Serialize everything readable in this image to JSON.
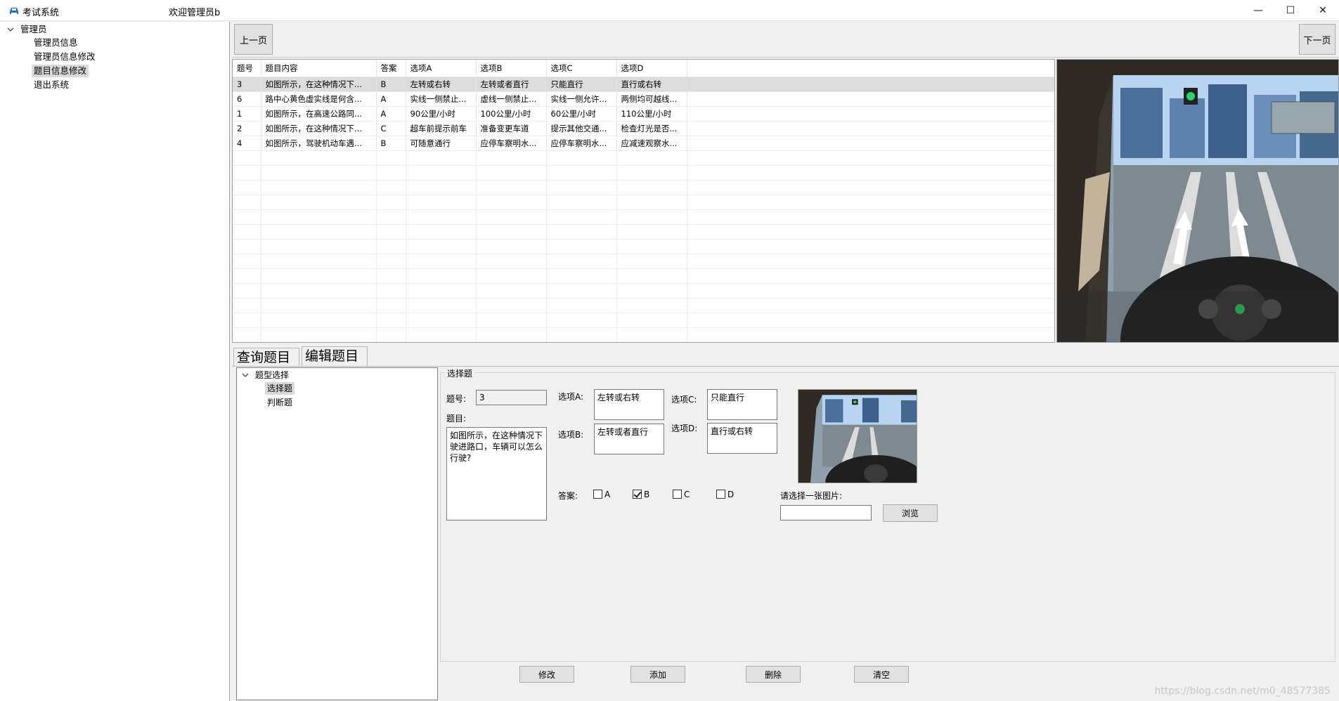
{
  "window": {
    "app_title": "考试系统",
    "welcome": "欢迎管理员b",
    "app_icon": "car-icon",
    "controls": {
      "minimize": "—",
      "maximize": "☐",
      "close": "✕"
    }
  },
  "nav": {
    "root": "管理员",
    "items": [
      {
        "label": "管理员信息"
      },
      {
        "label": "管理员信息修改"
      },
      {
        "label": "题目信息修改"
      },
      {
        "label": "退出系统"
      }
    ],
    "selected": "题目信息修改"
  },
  "pager": {
    "prev": "上一页",
    "next": "下一页"
  },
  "grid": {
    "columns": [
      "题号",
      "题目内容",
      "答案",
      "选项A",
      "选项B",
      "选项C",
      "选项D"
    ],
    "rows": [
      [
        "3",
        "如图所示，在这种情况下...",
        "B",
        "左转或右转",
        "左转或者直行",
        "只能直行",
        "直行或右转"
      ],
      [
        "6",
        "路中心黄色虚实线是何含...",
        "A",
        "实线一侧禁止...",
        "虚线一侧禁止...",
        "实线一侧允许...",
        "两侧均可越线..."
      ],
      [
        "1",
        "如图所示，在高速公路同...",
        "A",
        "90公里/小时",
        "100公里/小时",
        "60公里/小时",
        "110公里/小时"
      ],
      [
        "2",
        "如图所示，在这种情况下...",
        "C",
        "超车前提示前车",
        "准备变更车道",
        "提示其他交通...",
        "检查灯光是否..."
      ],
      [
        "4",
        "如图所示，驾驶机动车遇...",
        "B",
        "可随意通行",
        "应停车察明水...",
        "应停车察明水...",
        "应减速观察水..."
      ]
    ],
    "selected_row": 0
  },
  "tabs": {
    "query": "查询题目",
    "edit": "编辑题目"
  },
  "type_tree": {
    "root": "题型选择",
    "items": [
      "选择题",
      "判断题"
    ],
    "selected": "选择题"
  },
  "form": {
    "group_title": "选择题",
    "number_label": "题号:",
    "number_value": "3",
    "question_label": "题目:",
    "question_text": "如图所示，在这种情况下驶进路口，车辆可以怎么行驶?",
    "optA_label": "选项A:",
    "optA_value": "左转或右转",
    "optB_label": "选项B:",
    "optB_value": "左转或者直行",
    "optC_label": "选项C:",
    "optC_value": "只能直行",
    "optD_label": "选项D:",
    "optD_value": "直行或右转",
    "answer_label": "答案:",
    "answers": [
      {
        "label": "A",
        "checked": false
      },
      {
        "label": "B",
        "checked": true
      },
      {
        "label": "C",
        "checked": false
      },
      {
        "label": "D",
        "checked": false
      }
    ],
    "image_label": "请选择一张图片:",
    "image_path": "",
    "browse": "浏览"
  },
  "actions": {
    "modify": "修改",
    "add": "添加",
    "delete": "删除",
    "clear": "清空"
  },
  "watermark": "https://blog.csdn.net/m0_48577385",
  "colors": {
    "selection": "#d9d9d9",
    "window_bg": "#f0f0f0",
    "border": "#a0a0a0"
  }
}
